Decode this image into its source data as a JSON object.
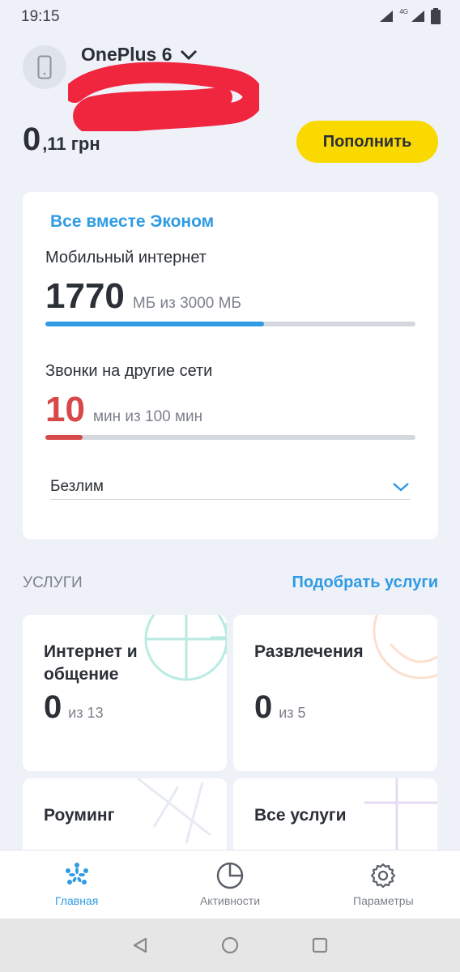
{
  "status_bar": {
    "time": "19:15",
    "network": "4G"
  },
  "account": {
    "device_name": "OnePlus 6",
    "device_icon": "phone-icon",
    "dropdown_icon": "chevron-down-icon"
  },
  "balance": {
    "integer": "0",
    "fraction": ",11 грн"
  },
  "topup_label": "Пополнить",
  "plan": {
    "name": "Все вместе Эконом",
    "internet": {
      "label": "Мобильный интернет",
      "value": "1770",
      "of": "МБ из 3000 МБ",
      "fraction": 0.59,
      "color": "#2f9be3"
    },
    "calls": {
      "label": "Звонки на другие сети",
      "value": "10",
      "of": "мин из 100 мин",
      "fraction": 0.1,
      "color": "#d84848"
    },
    "unlimited": "Безлим"
  },
  "services": {
    "title": "УСЛУГИ",
    "action": "Подобрать услуги",
    "cards": [
      {
        "title": "Интернет и общение",
        "count": "0",
        "of": "из 13"
      },
      {
        "title": "Развлечения",
        "count": "0",
        "of": "из 5"
      },
      {
        "title": "Роуминг"
      },
      {
        "title": "Все услуги"
      }
    ]
  },
  "nav": [
    {
      "label": "Главная",
      "icon": "kyivstar-star-icon",
      "active": true
    },
    {
      "label": "Активности",
      "icon": "pie-chart-icon",
      "active": false
    },
    {
      "label": "Параметры",
      "icon": "gear-icon",
      "active": false
    }
  ]
}
